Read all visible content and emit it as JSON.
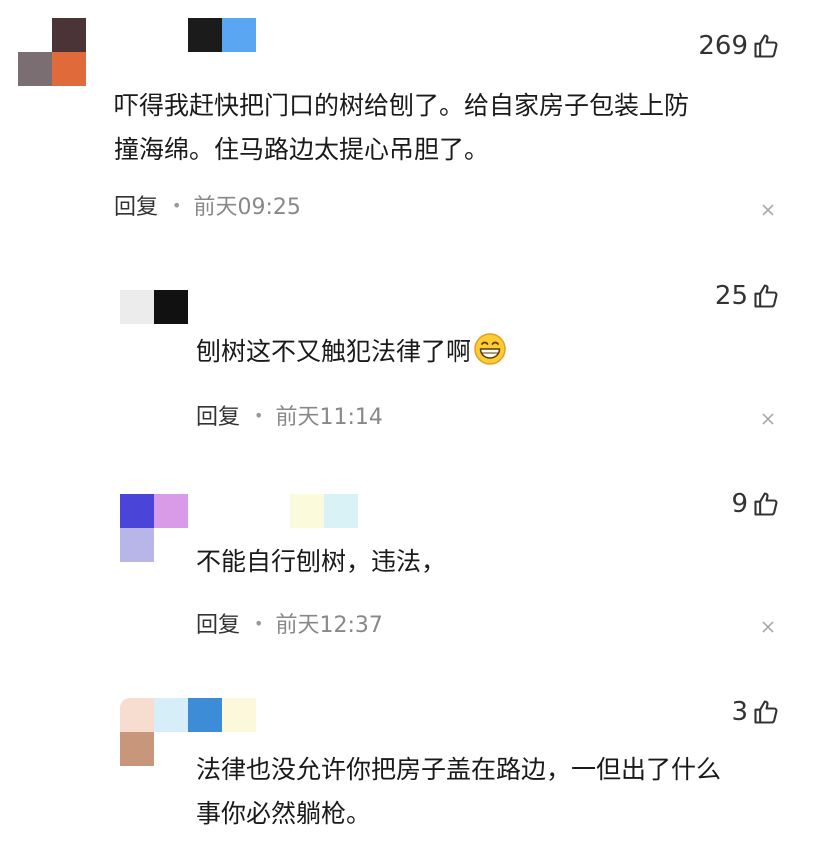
{
  "comments": [
    {
      "likes": "269",
      "text_lines": [
        "吓得我赶快把门口的树给刨了。给自家房子包装上防",
        "撞海绵。住马路边太提心吊胆了。"
      ],
      "reply_label": "回复",
      "time": "前天09:25"
    },
    {
      "likes": "25",
      "text_lines": [
        "刨树这不又触犯法律了啊"
      ],
      "emoji": "grinning-face-icon",
      "reply_label": "回复",
      "time": "前天11:14"
    },
    {
      "likes": "9",
      "text_lines": [
        "不能自行刨树，违法，"
      ],
      "reply_label": "回复",
      "time": "前天12:37"
    },
    {
      "likes": "3",
      "text_lines": [
        "法律也没允许你把房子盖在路边，一但出了什么",
        "事你必然躺枪。"
      ]
    }
  ],
  "colors": {
    "text": "#1a1a1a",
    "meta_time": "#888888",
    "icon": "#333333"
  }
}
